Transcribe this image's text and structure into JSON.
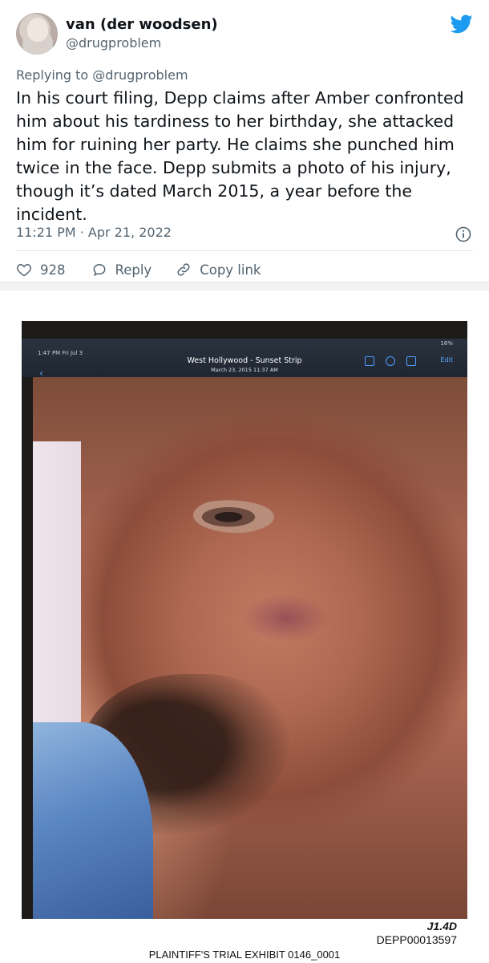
{
  "tweet": {
    "display_name": "van (der woodsen)",
    "handle": "@drugproblem",
    "replying_prefix": "Replying to ",
    "replying_to": "@drugproblem",
    "text": "In his court filing, Depp claims after Amber confronted him about his tardiness to her birthday, she attacked him for ruining her party. He claims she punched him twice in the face. Depp submits a photo of his injury, though it’s dated March 2015, a year before the incident.",
    "timestamp": "11:21 PM · Apr 21, 2022",
    "likes": "928",
    "reply_label": "Reply",
    "copy_link_label": "Copy link",
    "brand_color": "#1d9bf0"
  },
  "photo": {
    "status_left": "1:47 PM  Fri Jul 3",
    "status_right": "16%",
    "album_title": "West Hollywood - Sunset Strip",
    "album_subtitle": "March 23, 2015  11:37 AM",
    "edit_label": "Edit",
    "exhibit_id": "J1.4D",
    "bates_number": "DEPP00013597",
    "exhibit_caption": "PLAINTIFF'S TRIAL EXHIBIT 0146_0001"
  }
}
